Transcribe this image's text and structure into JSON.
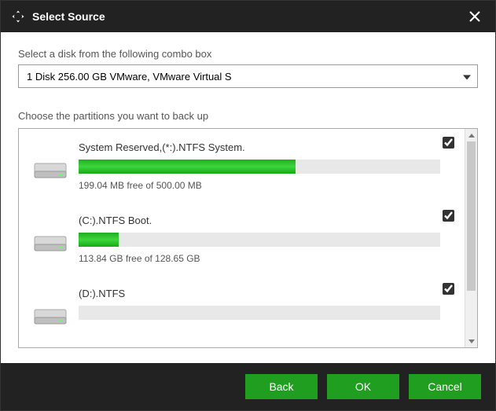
{
  "title": "Select Source",
  "label_combo": "Select a disk from the following combo box",
  "combo_value": "1 Disk 256.00 GB VMware,  VMware Virtual S",
  "label_partitions": "Choose the partitions you want to back up",
  "partitions": [
    {
      "name": "System Reserved,(*:).NTFS System.",
      "free": "199.04 MB free of 500.00 MB",
      "fill_pct": 60,
      "checked": true
    },
    {
      "name": "(C:).NTFS Boot.",
      "free": "113.84 GB free of 128.65 GB",
      "fill_pct": 11,
      "checked": true
    },
    {
      "name": "(D:).NTFS",
      "free": "",
      "fill_pct": 0,
      "checked": true
    }
  ],
  "buttons": {
    "back": "Back",
    "ok": "OK",
    "cancel": "Cancel"
  }
}
